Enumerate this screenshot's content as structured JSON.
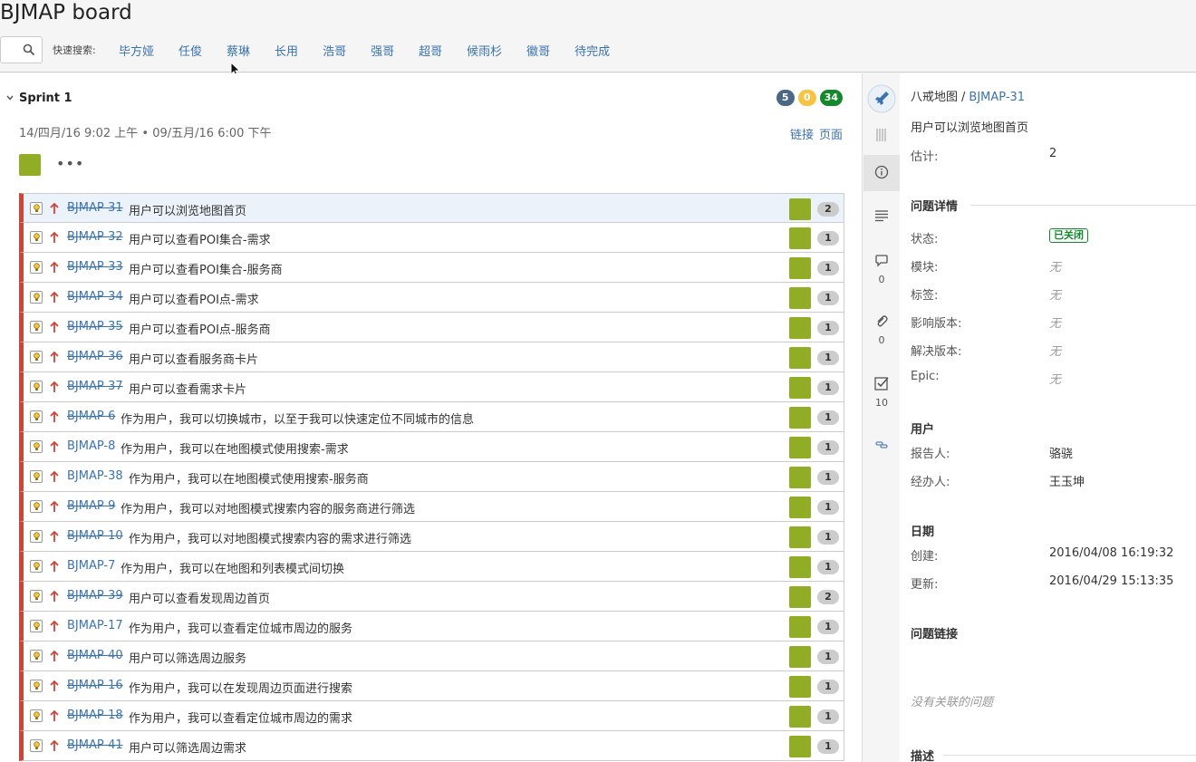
{
  "board": {
    "title": "BJMAP board"
  },
  "quick_search": {
    "label": "快速搜索:",
    "filters": [
      "毕方娅",
      "任俊",
      "蔡琳",
      "长用",
      "浩哥",
      "强哥",
      "超哥",
      "候雨杉",
      "徽哥",
      "待完成"
    ]
  },
  "sprint": {
    "name": "Sprint 1",
    "dates": "14/四月/16 9:02 上午 • 09/五月/16 6:00 下午",
    "link_label": "链接",
    "page_label": "页面",
    "badges": [
      {
        "value": "5",
        "color": "#4a6785"
      },
      {
        "value": "0",
        "color": "#f6c342"
      },
      {
        "value": "34",
        "color": "#14892c"
      }
    ],
    "more": "•••"
  },
  "issues": [
    {
      "key": "BJMAP-31",
      "summary": "用户可以浏览地图首页",
      "estimate": "2",
      "done": true,
      "selected": true
    },
    {
      "key": "BJMAP-32",
      "summary": "用户可以查看POI集合-需求",
      "estimate": "1",
      "done": true
    },
    {
      "key": "BJMAP-33",
      "summary": "用户可以查看POI集合-服务商",
      "estimate": "1",
      "done": true
    },
    {
      "key": "BJMAP-34",
      "summary": "用户可以查看POI点-需求",
      "estimate": "1",
      "done": true
    },
    {
      "key": "BJMAP-35",
      "summary": "用户可以查看POI点-服务商",
      "estimate": "1",
      "done": true
    },
    {
      "key": "BJMAP-36",
      "summary": "用户可以查看服务商卡片",
      "estimate": "1",
      "done": true
    },
    {
      "key": "BJMAP-37",
      "summary": "用户可以查看需求卡片",
      "estimate": "1",
      "done": true
    },
    {
      "key": "BJMAP-6",
      "summary": "作为用户，我可以切换城市，以至于我可以快速定位不同城市的信息",
      "estimate": "1",
      "done": true
    },
    {
      "key": "BJMAP-8",
      "summary": "作为用户，我可以在地图模式使用搜索-需求",
      "estimate": "1",
      "done": false
    },
    {
      "key": "BJMAP-38",
      "summary": "作为用户，我可以在地图模式使用搜索-服务商",
      "estimate": "1",
      "done": false
    },
    {
      "key": "BJMAP-9",
      "summary": "作为用户，我可以对地图模式搜索内容的服务商进行筛选",
      "estimate": "1",
      "done": true
    },
    {
      "key": "BJMAP-10",
      "summary": "作为用户，我可以对地图模式搜索内容的需求进行筛选",
      "estimate": "1",
      "done": true
    },
    {
      "key": "BJMAP-7",
      "summary": "作为用户，我可以在地图和列表模式间切换",
      "estimate": "1",
      "done": false
    },
    {
      "key": "BJMAP-39",
      "summary": "用户可以查看发现周边首页",
      "estimate": "2",
      "done": true
    },
    {
      "key": "BJMAP-17",
      "summary": "作为用户，我可以查看定位城市周边的服务",
      "estimate": "1",
      "done": false
    },
    {
      "key": "BJMAP-40",
      "summary": "用户可以筛选周边服务",
      "estimate": "1",
      "done": true
    },
    {
      "key": "BJMAP-16",
      "summary": "作为用户，我可以在发现周边页面进行搜索",
      "estimate": "1",
      "done": true
    },
    {
      "key": "BJMAP-18",
      "summary": "作为用户，我可以查看定位城市周边的需求",
      "estimate": "1",
      "done": true
    },
    {
      "key": "BJMAP-41",
      "summary": "用户可以筛选周边需求",
      "estimate": "1",
      "done": true
    }
  ],
  "rail": {
    "comments_count": "0",
    "attachments_count": "0",
    "subtasks_count": "10"
  },
  "detail": {
    "project": "八戒地图",
    "separator": "/",
    "key": "BJMAP-31",
    "summary": "用户可以浏览地图首页",
    "estimate_label": "估计:",
    "estimate_value": "2",
    "details_heading": "问题详情",
    "status_label": "状态:",
    "status_value": "已关闭",
    "component_label": "模块:",
    "component_value": "无",
    "labels_label": "标签:",
    "labels_value": "无",
    "affects_label": "影响版本:",
    "affects_value": "无",
    "fix_label": "解决版本:",
    "fix_value": "无",
    "epic_label": "Epic:",
    "epic_value": "无",
    "people_heading": "用户",
    "reporter_label": "报告人:",
    "reporter_value": "骆骁",
    "assignee_label": "经办人:",
    "assignee_value": "王玉坤",
    "dates_heading": "日期",
    "created_label": "创建:",
    "created_value": "2016/04/08 16:19:32",
    "updated_label": "更新:",
    "updated_value": "2016/04/29 15:13:35",
    "links_heading": "问题链接",
    "no_links": "没有关联的问题",
    "description_heading": "描述"
  }
}
